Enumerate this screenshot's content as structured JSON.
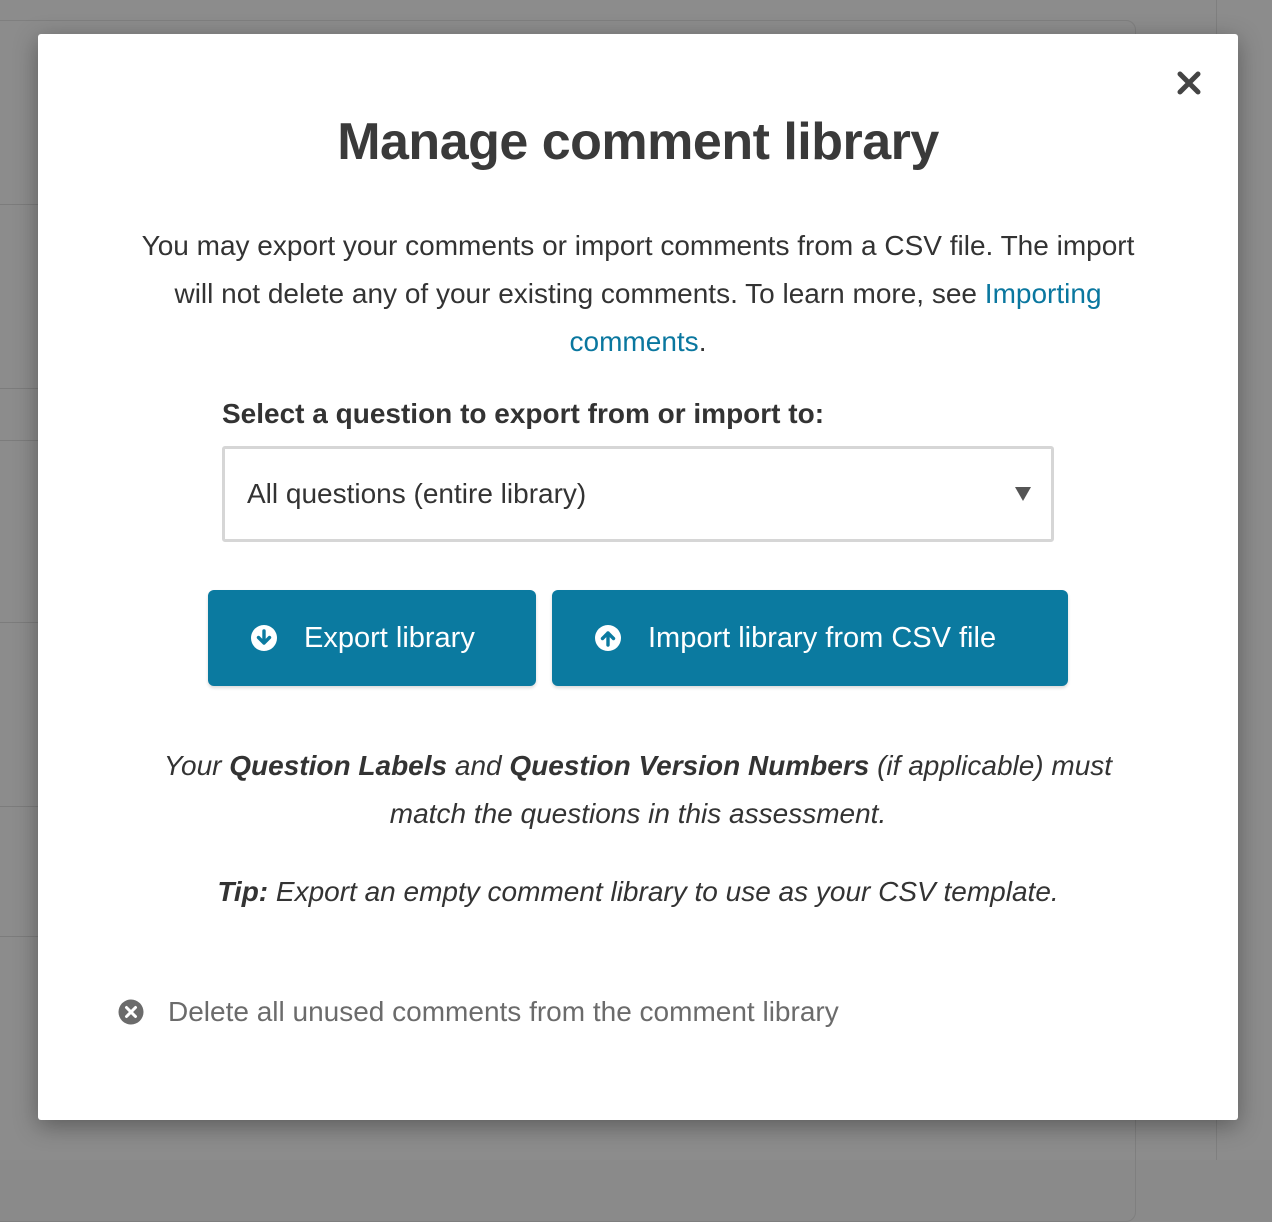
{
  "dialog": {
    "title": "Manage comment library",
    "close_icon": "close-icon",
    "intro_text": "You may export your comments or import comments from a CSV file. The import will not delete any of your existing comments. To learn more, see",
    "intro_link": "Importing comments",
    "intro_end": "."
  },
  "question_select": {
    "label": "Select a question to export from or import to:",
    "selected_value": "All questions (entire library)",
    "arrow_icon": "caret-down-icon"
  },
  "buttons": {
    "export_label": "Export library",
    "export_icon": "arrow-circle-down-icon",
    "import_label": "Import library from CSV file",
    "import_icon": "arrow-circle-up-icon"
  },
  "note": {
    "part1": "Your",
    "bold1": "Question Labels",
    "part2": "and",
    "bold2": "Question Version Numbers",
    "part3": "(if applicable) must match the questions in this assessment."
  },
  "tip": {
    "label": "Tip:",
    "text": "Export an empty comment library to use as your CSV template."
  },
  "delete_action": {
    "label": "Delete all unused comments from the comment library",
    "icon": "x-circle-icon"
  },
  "colors": {
    "accent": "#0b7aa0",
    "link": "#0a779f",
    "text": "#333333",
    "muted": "#6b6b6b"
  }
}
